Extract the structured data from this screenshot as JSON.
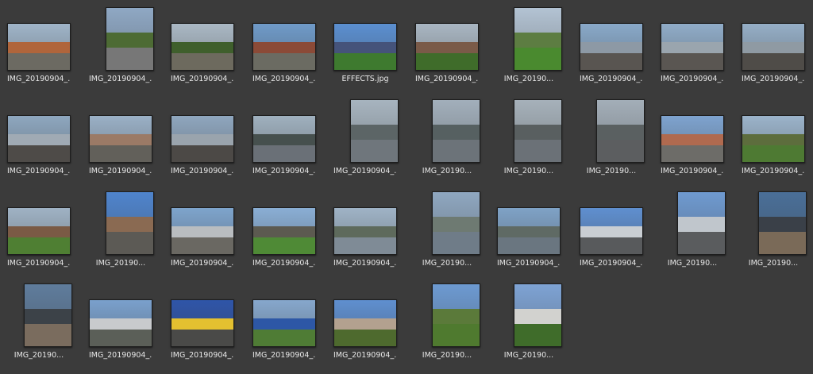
{
  "files": [
    {
      "label": "IMG_20190904_...",
      "sky": "#9fb4c8",
      "mid": "#b0653b",
      "ground": "#6c6a62",
      "orientation": "landscape"
    },
    {
      "label": "IMG_20190904_...",
      "sky": "#8fa8c4",
      "mid": "#4d6b34",
      "ground": "#777777",
      "orientation": "portrait"
    },
    {
      "label": "IMG_20190904_...",
      "sky": "#aab8c4",
      "mid": "#3f5f2c",
      "ground": "#6d6a5e",
      "orientation": "landscape"
    },
    {
      "label": "IMG_20190904_...",
      "sky": "#6f9ac8",
      "mid": "#8b4a37",
      "ground": "#6b6b62",
      "orientation": "landscape"
    },
    {
      "label": "EFFECTS.jpg",
      "sky": "#5b8fd0",
      "mid": "#45537a",
      "ground": "#3e7a2f",
      "orientation": "landscape"
    },
    {
      "label": "IMG_20190904_...",
      "sky": "#a9b6c2",
      "mid": "#7a5a48",
      "ground": "#3f6c2a",
      "orientation": "landscape"
    },
    {
      "label": "IMG_20190...",
      "sky": "#b3c3d3",
      "mid": "#5d7d42",
      "ground": "#4a8a2f",
      "orientation": "portrait"
    },
    {
      "label": "IMG_20190904_...",
      "sky": "#89a9c9",
      "mid": "#8d99a5",
      "ground": "#595551",
      "orientation": "landscape"
    },
    {
      "label": "IMG_20190904_...",
      "sky": "#90acc8",
      "mid": "#9aa5ae",
      "ground": "#5a5652",
      "orientation": "landscape"
    },
    {
      "label": "IMG_20190904_...",
      "sky": "#95aec6",
      "mid": "#8f9aa3",
      "ground": "#4f4c48",
      "orientation": "landscape"
    },
    {
      "label": "IMG_20190904_...",
      "sky": "#8ea7bf",
      "mid": "#a0aab4",
      "ground": "#4e4b48",
      "orientation": "landscape"
    },
    {
      "label": "IMG_20190904_...",
      "sky": "#9ab0c6",
      "mid": "#9b7a66",
      "ground": "#62605a",
      "orientation": "landscape"
    },
    {
      "label": "IMG_20190904_...",
      "sky": "#8fa6be",
      "mid": "#9aa4ad",
      "ground": "#4c4946",
      "orientation": "landscape"
    },
    {
      "label": "IMG_20190904_...",
      "sky": "#9fb0be",
      "mid": "#46504e",
      "ground": "#6a7077",
      "orientation": "landscape"
    },
    {
      "label": "IMG_20190904_...",
      "sky": "#a7b4bf",
      "mid": "#5c6566",
      "ground": "#6f767c",
      "orientation": "portrait"
    },
    {
      "label": "IMG_20190...",
      "sky": "#a2afbb",
      "mid": "#566061",
      "ground": "#6c7379",
      "orientation": "portrait"
    },
    {
      "label": "IMG_20190...",
      "sky": "#a6b1ba",
      "mid": "#595f60",
      "ground": "#6b7177",
      "orientation": "portrait"
    },
    {
      "label": "IMG_20190...",
      "sky": "#a3aeb8",
      "mid": "#5a6061",
      "ground": "#5c5e60",
      "orientation": "portrait"
    },
    {
      "label": "IMG_20190904_...",
      "sky": "#7ea3cf",
      "mid": "#b06a4f",
      "ground": "#6d6c68",
      "orientation": "landscape"
    },
    {
      "label": "IMG_20190904_...",
      "sky": "#9bb3ca",
      "mid": "#5d6d3d",
      "ground": "#4e7a33",
      "orientation": "landscape"
    },
    {
      "label": "IMG_20190904_...",
      "sky": "#9fb2c4",
      "mid": "#7a5a45",
      "ground": "#4f7f33",
      "orientation": "landscape"
    },
    {
      "label": "IMG_20190...",
      "sky": "#4f84cc",
      "mid": "#8a6a52",
      "ground": "#5c5a55",
      "orientation": "portrait"
    },
    {
      "label": "IMG_20190904_...",
      "sky": "#7ea4cc",
      "mid": "#b9bdc0",
      "ground": "#6a6862",
      "orientation": "landscape"
    },
    {
      "label": "IMG_20190904_...",
      "sky": "#8aaed4",
      "mid": "#5c5a50",
      "ground": "#4f8a36",
      "orientation": "landscape"
    },
    {
      "label": "IMG_20190904_...",
      "sky": "#9fb3c6",
      "mid": "#5e6a5c",
      "ground": "#7f8b96",
      "orientation": "landscape"
    },
    {
      "label": "IMG_20190...",
      "sky": "#8fa7c0",
      "mid": "#6e7a72",
      "ground": "#6f7c88",
      "orientation": "portrait"
    },
    {
      "label": "IMG_20190904_...",
      "sky": "#7fa2c6",
      "mid": "#5f6a64",
      "ground": "#6a7680",
      "orientation": "landscape"
    },
    {
      "label": "IMG_20190904_...",
      "sky": "#5f8fcf",
      "mid": "#c9ced3",
      "ground": "#585a5c",
      "orientation": "landscape"
    },
    {
      "label": "IMG_20190...",
      "sky": "#6f9ad0",
      "mid": "#c0c6cc",
      "ground": "#5a5c5e",
      "orientation": "portrait"
    },
    {
      "label": "IMG_20190...",
      "sky": "#4a6f98",
      "mid": "#3a4048",
      "ground": "#7a6a58",
      "orientation": "portrait"
    },
    {
      "label": "IMG_20190...",
      "sky": "#5f7c9c",
      "mid": "#3c4248",
      "ground": "#7a6c5e",
      "orientation": "portrait"
    },
    {
      "label": "IMG_20190904_...",
      "sky": "#7aa0cc",
      "mid": "#c8cacd",
      "ground": "#5b5f58",
      "orientation": "landscape"
    },
    {
      "label": "IMG_20190904_...",
      "sky": "#2f55a8",
      "mid": "#e3c030",
      "ground": "#4a4a48",
      "orientation": "landscape"
    },
    {
      "label": "IMG_20190904_...",
      "sky": "#86a7cc",
      "mid": "#2d57a6",
      "ground": "#4f7c35",
      "orientation": "landscape"
    },
    {
      "label": "IMG_20190904_...",
      "sky": "#5f8fcf",
      "mid": "#b3a18f",
      "ground": "#4e6a2e",
      "orientation": "landscape"
    },
    {
      "label": "IMG_20190...",
      "sky": "#6d9ad1",
      "mid": "#5b7a3a",
      "ground": "#4f7a2f",
      "orientation": "portrait"
    },
    {
      "label": "IMG_20190...",
      "sky": "#7ea3d4",
      "mid": "#d2d2cf",
      "ground": "#3f6c2a",
      "orientation": "portrait"
    }
  ]
}
